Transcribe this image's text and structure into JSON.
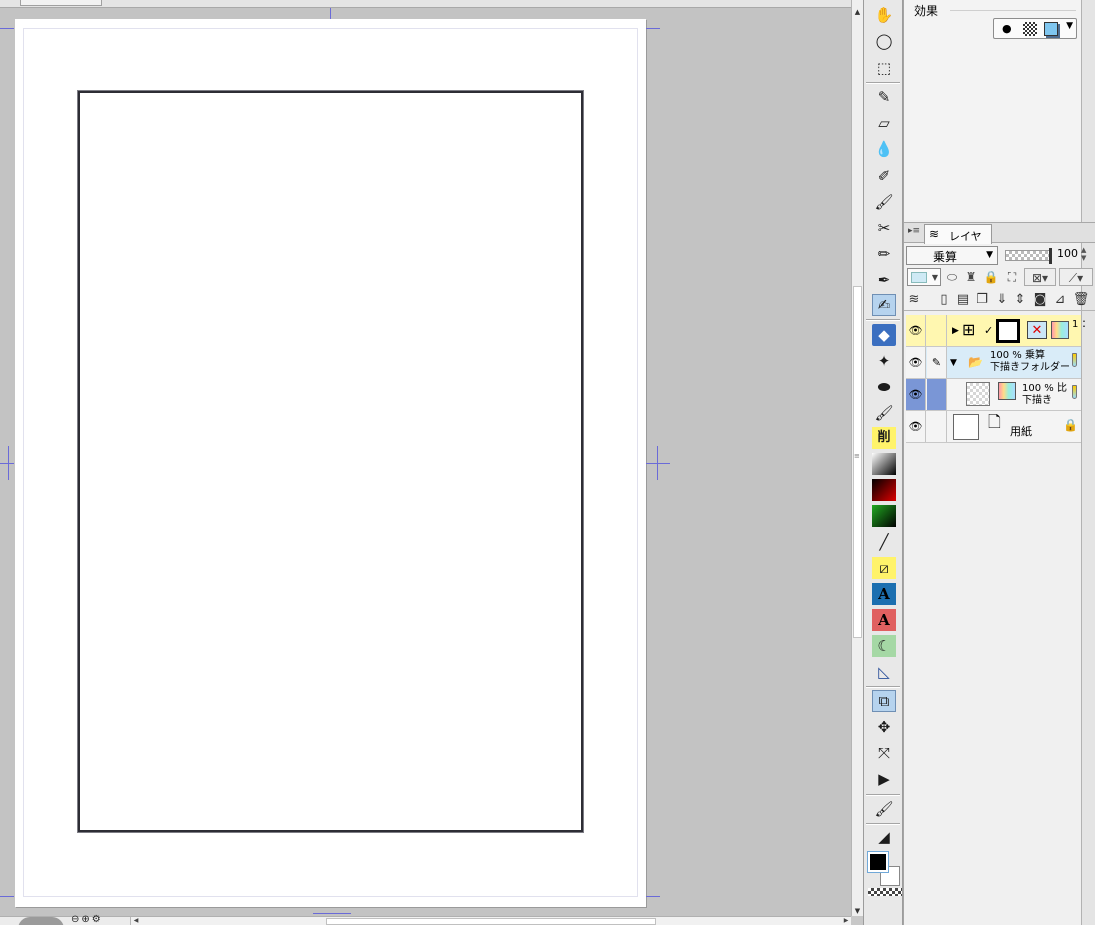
{
  "effect_panel": {
    "title": "効果",
    "picker_icons": [
      "circle-dot-icon",
      "checker-icon",
      "cube-icon",
      "dropdown-arrow-icon"
    ]
  },
  "layer_panel": {
    "tab_label": "レイヤー",
    "blend_mode": "乗算",
    "opacity": "100",
    "layers": [
      {
        "name": "",
        "type": "frame-folder",
        "checkmark": "✓",
        "truncated_text": "1 ："
      },
      {
        "name": "下描きフォルダー",
        "opacity": "100 %",
        "blend": "乗算",
        "type": "folder"
      },
      {
        "name": "下描き",
        "opacity": "100 %",
        "blend": "比",
        "type": "raster"
      },
      {
        "name": "用紙",
        "type": "paper",
        "locked": true
      }
    ]
  },
  "colors": {
    "main_color": "#000000",
    "sub_color": "#ffffff",
    "selected_layer": "#7a96d6",
    "frame_layer": "#fff7b0",
    "folder_layer": "#d9ecf8",
    "crop_marks": "#6a6ad8"
  },
  "toolbar": {
    "tools": [
      "hand-icon",
      "lasso-icon",
      "rect-select-icon",
      "pen-icon",
      "eraser-icon",
      "blend-drops-icon",
      "airbrush-icon",
      "brush-icon",
      "decoration-icon",
      "pencil-icon",
      "dropper-icon",
      "g-pen-icon",
      "fill-icon",
      "fill-correct-icon",
      "fill-lasso-icon",
      "fill-more-icon",
      "text-erase-icon",
      "gradient-black-icon",
      "gradient-red-icon",
      "gradient-green-icon",
      "line-icon",
      "frame-icon",
      "text-blue-icon",
      "text-red-icon",
      "balloon-icon",
      "ruler-icon",
      "object-icon",
      "layer-move-icon",
      "transform-icon",
      "operation-icon",
      "correct-line-icon",
      "brush-shape-icon"
    ],
    "text_erase_glyph": "削",
    "text_tool_glyph": "A"
  }
}
